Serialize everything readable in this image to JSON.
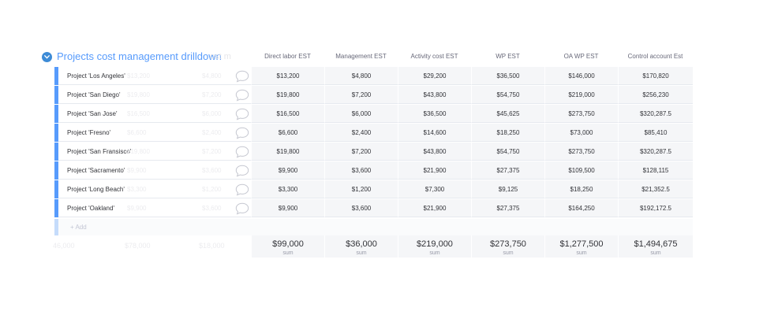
{
  "group": {
    "title": "Projects cost management drilldown",
    "accent_color": "#579bfc",
    "toggle_icon": "chevron-down-circle-icon",
    "ghost_title": "ost m"
  },
  "columns": [
    {
      "label": "Direct labor EST"
    },
    {
      "label": "Management EST"
    },
    {
      "label": "Activity cost EST"
    },
    {
      "label": "WP EST"
    },
    {
      "label": "OA WP EST"
    },
    {
      "label": "Control account Est"
    }
  ],
  "rows": [
    {
      "name": "Project 'Los Angeles'",
      "ghost1": "$13,200",
      "ghost2": "$4,800",
      "values": [
        "$13,200",
        "$4,800",
        "$29,200",
        "$36,500",
        "$146,000",
        "$170,820"
      ]
    },
    {
      "name": "Project 'San Diego'",
      "ghost1": "$19,800",
      "ghost2": "$7,200",
      "values": [
        "$19,800",
        "$7,200",
        "$43,800",
        "$54,750",
        "$219,000",
        "$256,230"
      ]
    },
    {
      "name": "Project 'San Jose'",
      "ghost1": "$16,500",
      "ghost2": "$6,000",
      "values": [
        "$16,500",
        "$6,000",
        "$36,500",
        "$45,625",
        "$273,750",
        "$320,287.5"
      ]
    },
    {
      "name": "Project 'Fresno'",
      "ghost1": "$6,600",
      "ghost2": "$2,400",
      "values": [
        "$6,600",
        "$2,400",
        "$14,600",
        "$18,250",
        "$73,000",
        "$85,410"
      ]
    },
    {
      "name": "Project 'San Fransisco'",
      "ghost1": "$19,800",
      "ghost2": "$7,200",
      "values": [
        "$19,800",
        "$7,200",
        "$43,800",
        "$54,750",
        "$273,750",
        "$320,287.5"
      ]
    },
    {
      "name": "Project 'Sacramento'",
      "ghost1": "$9,900",
      "ghost2": "$3,600",
      "values": [
        "$9,900",
        "$3,600",
        "$21,900",
        "$27,375",
        "$109,500",
        "$128,115"
      ]
    },
    {
      "name": "Project 'Long Beach'",
      "ghost1": "$3,300",
      "ghost2": "$1,200",
      "values": [
        "$3,300",
        "$1,200",
        "$7,300",
        "$9,125",
        "$18,250",
        "$21,352.5"
      ]
    },
    {
      "name": "Project 'Oakland'",
      "ghost1": "$9,900",
      "ghost2": "$3,600",
      "values": [
        "$9,900",
        "$3,600",
        "$21,900",
        "$27,375",
        "$164,250",
        "$192,172.5"
      ]
    }
  ],
  "add_row": {
    "label": "+ Add"
  },
  "summary": {
    "ghost_values": [
      "46,000",
      "$78,000",
      "$18,000"
    ],
    "label": "sum",
    "values": [
      "$99,000",
      "$36,000",
      "$219,000",
      "$273,750",
      "$1,277,500",
      "$1,494,675"
    ]
  }
}
